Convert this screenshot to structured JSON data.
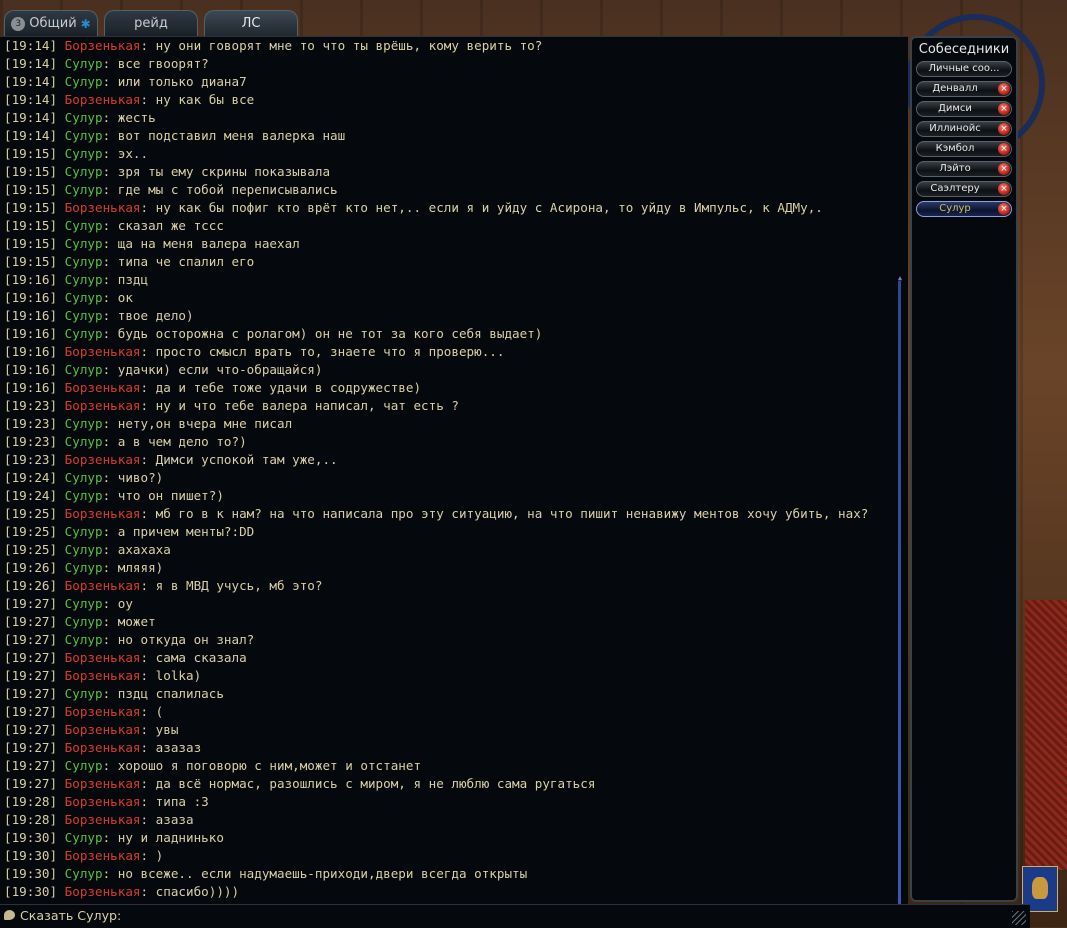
{
  "tabs": [
    {
      "label": "Общий",
      "badge": "3",
      "star": "✱"
    },
    {
      "label": "рейд"
    },
    {
      "label": "ЛС"
    }
  ],
  "colors": {
    "timestamp": "#d9cfa8",
    "borzenkaya": "#d83c2c",
    "sulur": "#58c040"
  },
  "messages": [
    {
      "time": "[19:14]",
      "name": "Борзенькая",
      "who": "b",
      "text": ": ну они говорят мне то что ты врёшь, кому верить то?"
    },
    {
      "time": "[19:14]",
      "name": "Сулур",
      "who": "s",
      "text": ": все гвоорят?"
    },
    {
      "time": "[19:14]",
      "name": "Сулур",
      "who": "s",
      "text": ": или только диана7"
    },
    {
      "time": "[19:14]",
      "name": "Борзенькая",
      "who": "b",
      "text": ": ну как бы все"
    },
    {
      "time": "[19:14]",
      "name": "Сулур",
      "who": "s",
      "text": ": жесть"
    },
    {
      "time": "[19:14]",
      "name": "Сулур",
      "who": "s",
      "text": ": вот подставил меня валерка наш"
    },
    {
      "time": "[19:15]",
      "name": "Сулур",
      "who": "s",
      "text": ": эх.."
    },
    {
      "time": "[19:15]",
      "name": "Сулур",
      "who": "s",
      "text": ": зря ты ему скрины показывала"
    },
    {
      "time": "[19:15]",
      "name": "Сулур",
      "who": "s",
      "text": ": где мы с тобой переписывались"
    },
    {
      "time": "[19:15]",
      "name": "Борзенькая",
      "who": "b",
      "text": ": ну как бы пофиг кто врёт кто нет,.. если я и уйду с Асирона, то уйду в Импульс, к АДМу,."
    },
    {
      "time": "[19:15]",
      "name": "Сулур",
      "who": "s",
      "text": ": сказал же тссс"
    },
    {
      "time": "[19:15]",
      "name": "Сулур",
      "who": "s",
      "text": ": ща на меня валера наехал"
    },
    {
      "time": "[19:15]",
      "name": "Сулур",
      "who": "s",
      "text": ": типа че спалил его"
    },
    {
      "time": "[19:16]",
      "name": "Сулур",
      "who": "s",
      "text": ": пздц"
    },
    {
      "time": "[19:16]",
      "name": "Сулур",
      "who": "s",
      "text": ": ок"
    },
    {
      "time": "[19:16]",
      "name": "Сулур",
      "who": "s",
      "text": ": твое дело)"
    },
    {
      "time": "[19:16]",
      "name": "Сулур",
      "who": "s",
      "text": ": будь осторожна с ролагом) он не тот за кого себя выдает)"
    },
    {
      "time": "[19:16]",
      "name": "Борзенькая",
      "who": "b",
      "text": ": просто смысл врать то, знаете что я проверю..."
    },
    {
      "time": "[19:16]",
      "name": "Сулур",
      "who": "s",
      "text": ": удачки) если что-обращайся)"
    },
    {
      "time": "[19:16]",
      "name": "Борзенькая",
      "who": "b",
      "text": ": да и тебе тоже удачи в содружестве)"
    },
    {
      "time": "[19:23]",
      "name": "Борзенькая",
      "who": "b",
      "text": ": ну и что тебе валера написал, чат есть ?"
    },
    {
      "time": "[19:23]",
      "name": "Сулур",
      "who": "s",
      "text": ": нету,он вчера мне писал"
    },
    {
      "time": "[19:23]",
      "name": "Сулур",
      "who": "s",
      "text": ": а в чем дело то?)"
    },
    {
      "time": "[19:23]",
      "name": "Борзенькая",
      "who": "b",
      "text": ": Димси успокой там уже,.."
    },
    {
      "time": "[19:24]",
      "name": "Сулур",
      "who": "s",
      "text": ": чиво?)"
    },
    {
      "time": "[19:24]",
      "name": "Сулур",
      "who": "s",
      "text": ": что он пишет?)"
    },
    {
      "time": "[19:25]",
      "name": "Борзенькая",
      "who": "b",
      "text": ": мб го в к нам? на что написала про эту ситуацию, на что пишит ненавижу ментов хочу убить, нах?"
    },
    {
      "time": "[19:25]",
      "name": "Сулур",
      "who": "s",
      "text": ": а причем менты?:DD"
    },
    {
      "time": "[19:25]",
      "name": "Сулур",
      "who": "s",
      "text": ": ахахаха"
    },
    {
      "time": "[19:26]",
      "name": "Сулур",
      "who": "s",
      "text": ": мляяя)"
    },
    {
      "time": "[19:26]",
      "name": "Борзенькая",
      "who": "b",
      "text": ": я в МВД учусь, мб это?"
    },
    {
      "time": "[19:27]",
      "name": "Сулур",
      "who": "s",
      "text": ": оу"
    },
    {
      "time": "[19:27]",
      "name": "Сулур",
      "who": "s",
      "text": ": может"
    },
    {
      "time": "[19:27]",
      "name": "Сулур",
      "who": "s",
      "text": ": но откуда он знал?"
    },
    {
      "time": "[19:27]",
      "name": "Борзенькая",
      "who": "b",
      "text": ": сама сказала"
    },
    {
      "time": "[19:27]",
      "name": "Борзенькая",
      "who": "b",
      "text": ": lolka)"
    },
    {
      "time": "[19:27]",
      "name": "Сулур",
      "who": "s",
      "text": ": пздц спалилась"
    },
    {
      "time": "[19:27]",
      "name": "Борзенькая",
      "who": "b",
      "text": ": ("
    },
    {
      "time": "[19:27]",
      "name": "Борзенькая",
      "who": "b",
      "text": ": увы"
    },
    {
      "time": "[19:27]",
      "name": "Борзенькая",
      "who": "b",
      "text": ": азазаз"
    },
    {
      "time": "[19:27]",
      "name": "Сулур",
      "who": "s",
      "text": ": хорошо я поговорю с ним,может и отстанет"
    },
    {
      "time": "[19:27]",
      "name": "Борзенькая",
      "who": "b",
      "text": ": да всё нормас, разошлись с миром, я не люблю сама ругаться"
    },
    {
      "time": "[19:28]",
      "name": "Борзенькая",
      "who": "b",
      "text": ": типа :3"
    },
    {
      "time": "[19:28]",
      "name": "Борзенькая",
      "who": "b",
      "text": ": азаза"
    },
    {
      "time": "[19:30]",
      "name": "Сулур",
      "who": "s",
      "text": ": ну и ладнинько"
    },
    {
      "time": "[19:30]",
      "name": "Борзенькая",
      "who": "b",
      "text": ": )"
    },
    {
      "time": "[19:30]",
      "name": "Сулур",
      "who": "s",
      "text": ": но всеже.. если надумаешь-приходи,двери всегда открыты"
    },
    {
      "time": "[19:30]",
      "name": "Борзенькая",
      "who": "b",
      "text": ": спасибо))))"
    }
  ],
  "sidebar": {
    "title": "Собеседники",
    "contacts": [
      {
        "label": "Личные соо...",
        "closable": false,
        "active": false
      },
      {
        "label": "Денвалл",
        "closable": true,
        "active": false
      },
      {
        "label": "Димси",
        "closable": true,
        "active": false
      },
      {
        "label": "Иллинойс",
        "closable": true,
        "active": false
      },
      {
        "label": "Кэмбол",
        "closable": true,
        "active": false
      },
      {
        "label": "Лэйто",
        "closable": true,
        "active": false
      },
      {
        "label": "Саэлтеру",
        "closable": true,
        "active": false
      },
      {
        "label": "Сулур",
        "closable": true,
        "active": true
      }
    ]
  },
  "input": {
    "label": "Сказать Сулур:",
    "value": ""
  }
}
